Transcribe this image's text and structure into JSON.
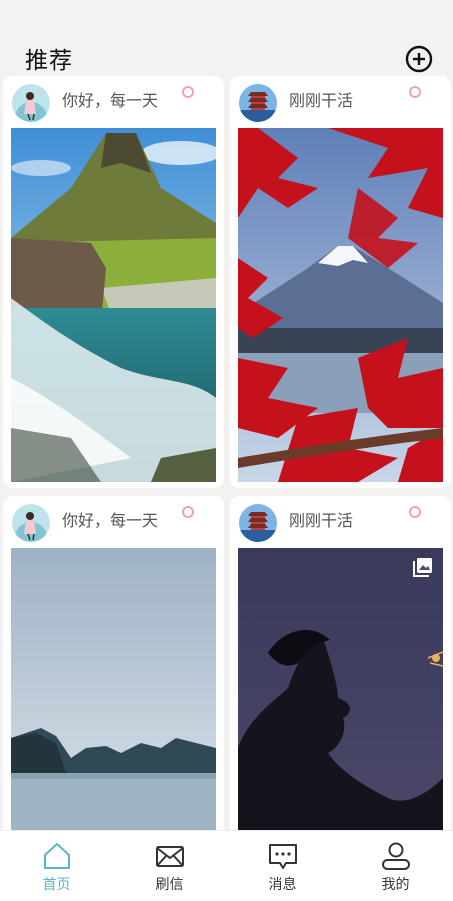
{
  "header": {
    "title": "推荐"
  },
  "cards": [
    {
      "author": "你好，每一天"
    },
    {
      "author": "刚刚干活"
    },
    {
      "author": "你好，每一天"
    },
    {
      "author": "刚刚干活"
    }
  ],
  "tabbar": {
    "items": [
      {
        "label": "首页",
        "icon": "home-icon",
        "active": true
      },
      {
        "label": "刷信",
        "icon": "mail-icon",
        "active": false
      },
      {
        "label": "消息",
        "icon": "message-icon",
        "active": false
      },
      {
        "label": "我的",
        "icon": "profile-icon",
        "active": false
      }
    ],
    "active_color": "#5bb5c9",
    "inactive_color": "#333333"
  }
}
